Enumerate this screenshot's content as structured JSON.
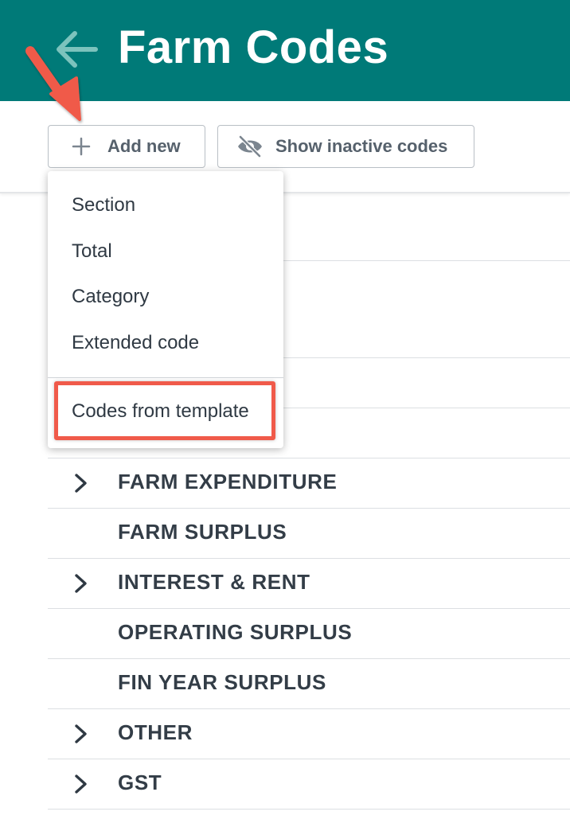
{
  "header": {
    "title": "Farm Codes",
    "back_icon": "arrow-left-icon",
    "background_color": "#007a78"
  },
  "toolbar": {
    "add_new_label": "Add new",
    "add_icon": "plus-icon",
    "show_inactive_label": "Show inactive codes",
    "show_inactive_icon": "eye-off-icon"
  },
  "add_menu": {
    "items": [
      "Section",
      "Total",
      "Category",
      "Extended code"
    ],
    "template_item": "Codes from template"
  },
  "code_rows": [
    {
      "label": "FARM EXPENDITURE",
      "expandable": true
    },
    {
      "label": "FARM SURPLUS",
      "expandable": false
    },
    {
      "label": "INTEREST & RENT",
      "expandable": true
    },
    {
      "label": "OPERATING SURPLUS",
      "expandable": false
    },
    {
      "label": "FIN YEAR SURPLUS",
      "expandable": false
    },
    {
      "label": "OTHER",
      "expandable": true
    },
    {
      "label": "GST",
      "expandable": true
    }
  ],
  "annotation": {
    "arrow_color": "#f05a4a",
    "highlight_color": "#f05a4a"
  }
}
